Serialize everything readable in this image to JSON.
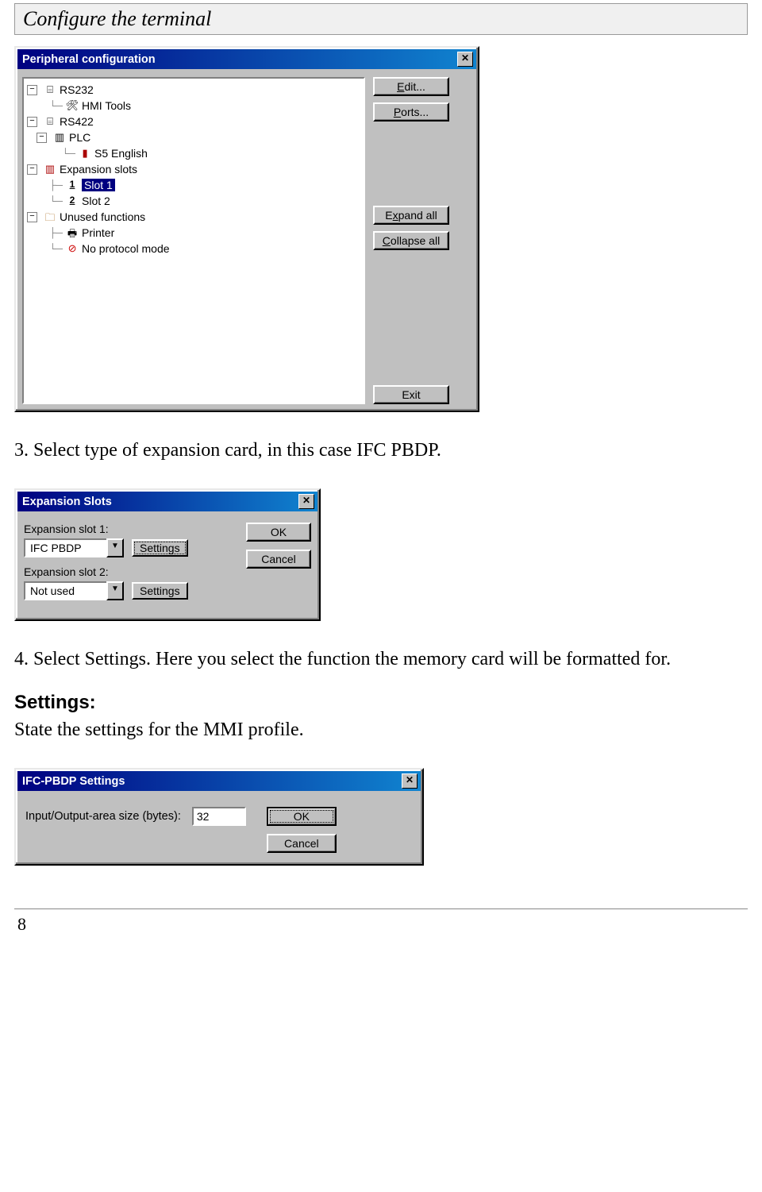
{
  "header": {
    "title": "Configure the terminal"
  },
  "step3": "3. Select type of expansion card, in this case IFC PBDP.",
  "step4": "4. Select Settings. Here you select the function the memory card will be formatted for.",
  "settings_heading": "Settings:",
  "settings_text": "State the settings for the MMI profile.",
  "page_number": "8",
  "periph": {
    "title": "Peripheral configuration",
    "close": "✕",
    "buttons": {
      "edit": "Edit...",
      "ports": "Ports...",
      "expand": "Expand all",
      "collapse": "Collapse all",
      "exit": "Exit"
    },
    "tree": {
      "rs232": "RS232",
      "hmi": "HMI Tools",
      "rs422": "RS422",
      "plc": "PLC",
      "s5": "S5 English",
      "expansion": "Expansion slots",
      "slot1_num": "1",
      "slot1": "Slot 1",
      "slot2_num": "2",
      "slot2": "Slot 2",
      "unused": "Unused functions",
      "printer": "Printer",
      "noprot": "No protocol mode"
    }
  },
  "expslots": {
    "title": "Expansion Slots",
    "close": "✕",
    "label1": "Expansion slot 1:",
    "value1": "IFC PBDP",
    "settings1": "Settings",
    "label2": "Expansion slot 2:",
    "value2": "Not used",
    "settings2": "Settings",
    "ok": "OK",
    "cancel": "Cancel"
  },
  "ifc": {
    "title": "IFC-PBDP Settings",
    "close": "✕",
    "label": "Input/Output-area size (bytes):",
    "value": "32",
    "ok": "OK",
    "cancel": "Cancel"
  },
  "underline_letters": {
    "E": "E",
    "P": "P",
    "x": "x",
    "C": "C"
  }
}
